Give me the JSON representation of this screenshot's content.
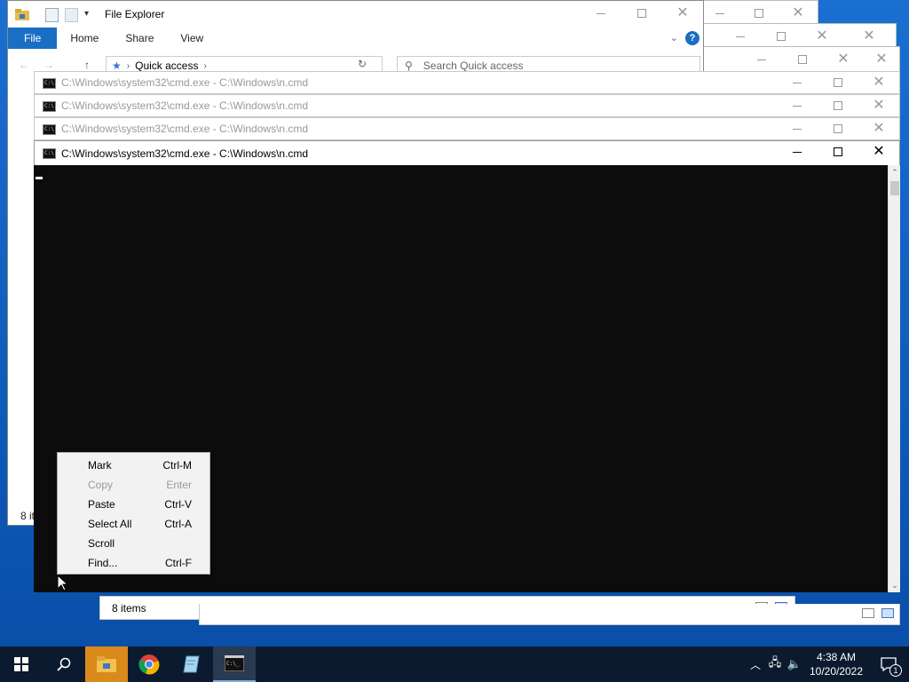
{
  "explorer": {
    "title": "File Explorer",
    "tabs": [
      "File",
      "Home",
      "Share",
      "View"
    ],
    "address": "Quick access",
    "search_placeholder": "Search Quick access",
    "status_items_left": "8 it",
    "status_items": "8 items"
  },
  "cmd_windows": [
    {
      "title": "C:\\Windows\\system32\\cmd.exe - C:\\Windows\\n.cmd"
    },
    {
      "title": "C:\\Windows\\system32\\cmd.exe - C:\\Windows\\n.cmd"
    },
    {
      "title": "C:\\Windows\\system32\\cmd.exe - C:\\Windows\\n.cmd"
    },
    {
      "title": "C:\\Windows\\system32\\cmd.exe - C:\\Windows\\n.cmd"
    }
  ],
  "cmd_icon_text": "C:\\.",
  "context_menu": [
    {
      "label": "Mark",
      "shortcut": "Ctrl-M",
      "enabled": true
    },
    {
      "label": "Copy",
      "shortcut": "Enter",
      "enabled": false
    },
    {
      "label": "Paste",
      "shortcut": "Ctrl-V",
      "enabled": true
    },
    {
      "label": "Select All",
      "shortcut": "Ctrl-A",
      "enabled": true
    },
    {
      "label": "Scroll",
      "shortcut": "",
      "enabled": true
    },
    {
      "label": "Find...",
      "shortcut": "Ctrl-F",
      "enabled": true
    }
  ],
  "taskbar": {
    "apps": [
      "start",
      "search",
      "file-explorer",
      "chrome",
      "notepad",
      "cmd"
    ],
    "time": "4:38 AM",
    "date": "10/20/2022",
    "notification_count": "1"
  },
  "colors": {
    "desktop": "#0e5cbc",
    "taskbar": "#0b1a2e",
    "file_tab": "#1a6ec4",
    "console_bg": "#0c0c0c"
  }
}
